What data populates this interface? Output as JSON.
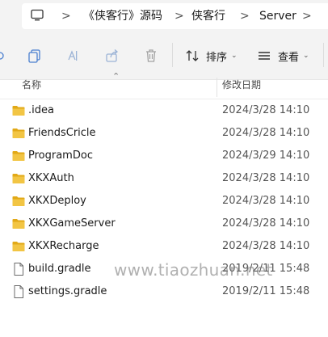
{
  "address_bar": {
    "crumbs": [
      "《侠客行》源码",
      "侠客行",
      "Server"
    ],
    "separator": ">"
  },
  "toolbar": {
    "sort_label": "排序",
    "view_label": "查看"
  },
  "header": {
    "name_col": "名称",
    "date_col": "修改日期"
  },
  "files": [
    {
      "name": ".idea",
      "type": "folder",
      "date": "2024/3/28 14:10"
    },
    {
      "name": "FriendsCricle",
      "type": "folder",
      "date": "2024/3/28 14:10"
    },
    {
      "name": "ProgramDoc",
      "type": "folder",
      "date": "2024/3/29 14:10"
    },
    {
      "name": "XKXAuth",
      "type": "folder",
      "date": "2024/3/28 14:10"
    },
    {
      "name": "XKXDeploy",
      "type": "folder",
      "date": "2024/3/28 14:10"
    },
    {
      "name": "XKXGameServer",
      "type": "folder",
      "date": "2024/3/28 14:10"
    },
    {
      "name": "XKXRecharge",
      "type": "folder",
      "date": "2024/3/28 14:10"
    },
    {
      "name": "build.gradle",
      "type": "file",
      "date": "2019/2/11 15:48"
    },
    {
      "name": "settings.gradle",
      "type": "file",
      "date": "2019/2/11 15:48"
    }
  ],
  "watermark": "www.tiaozhuan.net",
  "colors": {
    "folder": "#f2c544",
    "folder_dark": "#e2a917",
    "chrome_bg": "#f3f3f3"
  }
}
